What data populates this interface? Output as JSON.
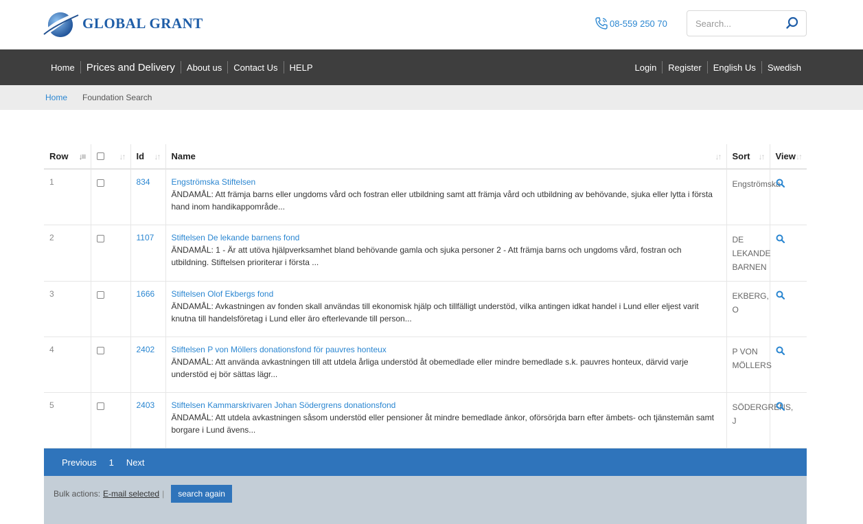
{
  "header": {
    "logo_text": "GLOBAL GRANT",
    "phone": "08-559 250 70",
    "search_placeholder": "Search..."
  },
  "nav": {
    "left": [
      {
        "label": "Home",
        "size": "normal"
      },
      {
        "label": "Prices and Delivery",
        "size": "big"
      },
      {
        "label": "About us",
        "size": "normal"
      },
      {
        "label": "Contact Us",
        "size": "normal"
      },
      {
        "label": "HELP",
        "size": "normal"
      }
    ],
    "right": [
      {
        "label": "Login"
      },
      {
        "label": "Register"
      },
      {
        "label": "English Us"
      },
      {
        "label": "Swedish"
      }
    ]
  },
  "breadcrumb": {
    "home": "Home",
    "current": "Foundation Search"
  },
  "table": {
    "headers": {
      "row": "Row",
      "id": "Id",
      "name": "Name",
      "sort": "Sort",
      "view": "View"
    },
    "rows": [
      {
        "row": "1",
        "id": "834",
        "name": "Engströmska Stiftelsen",
        "desc": "ÄNDAMÅL: Att främja barns eller ungdoms vård och fostran eller utbildning samt att främja vård och utbildning av behövande, sjuka eller lytta i första hand inom handikappområde...",
        "sort": "Engströmska"
      },
      {
        "row": "2",
        "id": "1107",
        "name": "Stiftelsen De lekande barnens fond",
        "desc": "ÄNDAMÅL: 1 - Är att utöva hjälpverksamhet bland behövande gamla och sjuka personer 2 - Att främja barns och ungdoms vård, fostran och utbildning. Stiftelsen prioriterar i första ...",
        "sort": "DE LEKANDE BARNEN"
      },
      {
        "row": "3",
        "id": "1666",
        "name": "Stiftelsen Olof Ekbergs fond",
        "desc": "ÄNDAMÅL: Avkastningen av fonden skall användas till ekonomisk hjälp och tillfälligt understöd, vilka antingen idkat handel i Lund eller eljest varit knutna till handelsföretag i Lund eller äro efterlevande till person...",
        "sort": "EKBERG, O"
      },
      {
        "row": "4",
        "id": "2402",
        "name": "Stiftelsen P von Möllers donationsfond för pauvres honteux",
        "desc": "ÄNDAMÅL: Att använda avkastningen till att utdela årliga understöd åt obemedlade eller mindre bemedlade s.k. pauvres honteux, därvid varje understöd ej bör sättas lägr...",
        "sort": "P VON MÖLLERS"
      },
      {
        "row": "5",
        "id": "2403",
        "name": "Stiftelsen Kammarskrivaren Johan Södergrens donationsfond",
        "desc": "ÄNDAMÅL: Att utdela avkastningen såsom understöd eller pensioner åt mindre bemedlade änkor, oförsörjda barn efter ämbets- och tjänstemän samt borgare i Lund ävens...",
        "sort": "SÖDERGRENS, J"
      }
    ]
  },
  "pager": {
    "previous": "Previous",
    "page": "1",
    "next": "Next"
  },
  "bulk": {
    "label": "Bulk actions:",
    "email_link": "E-mail selected",
    "separator": "|",
    "search_again": "search again"
  },
  "colors": {
    "brand": "#1f5ea8",
    "link": "#2a86d1",
    "navbar": "#3e3e3e",
    "pager": "#2f74bb",
    "bulk_bg": "#c4ced7"
  }
}
